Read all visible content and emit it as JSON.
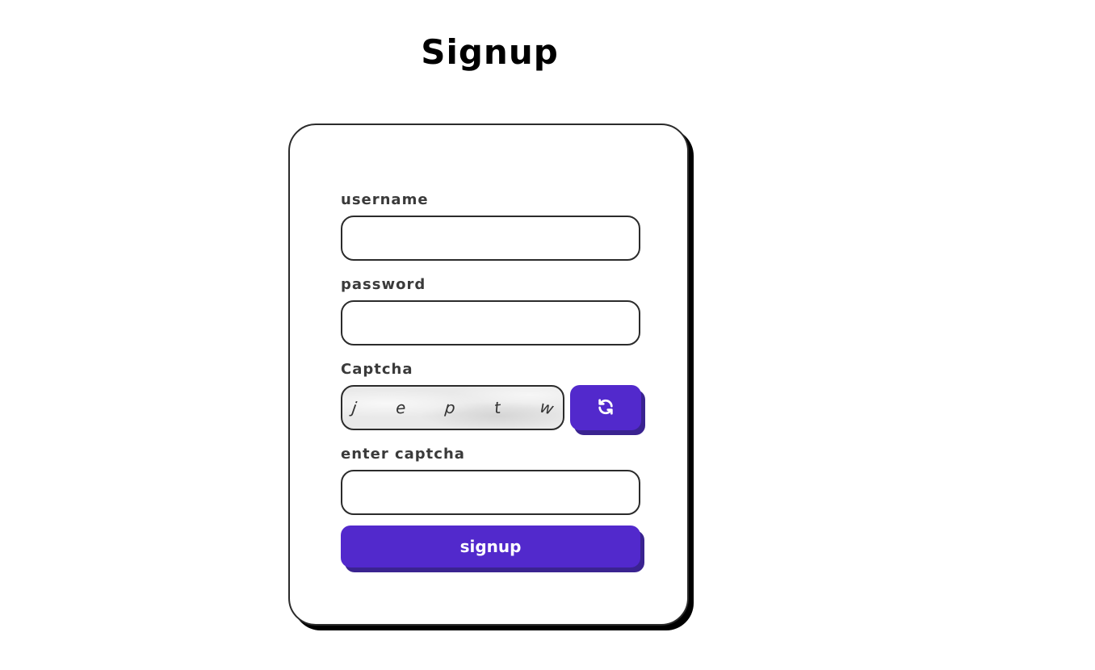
{
  "page": {
    "title": "Signup"
  },
  "form": {
    "username_label": "username",
    "username_value": "",
    "password_label": "password",
    "password_value": "",
    "captcha_label": "Captcha",
    "captcha_chars": [
      "j",
      "e",
      "p",
      "t",
      "w"
    ],
    "refresh_icon": "refresh-icon",
    "enter_captcha_label": "enter captcha",
    "enter_captcha_value": "",
    "submit_label": "signup"
  },
  "colors": {
    "accent": "#5229cc",
    "accent_shadow": "#3a2390",
    "border": "#2b2b2b",
    "label": "#3a3a3a"
  }
}
